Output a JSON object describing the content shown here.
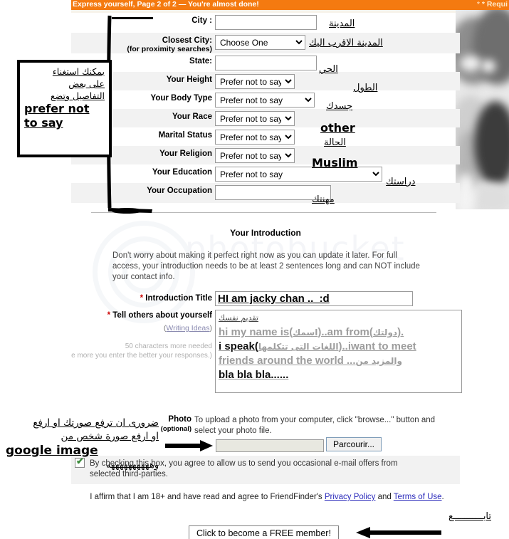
{
  "header": {
    "title": "Express yourself, Page 2 of 2 — You're almost done!",
    "required_note": "* Requi",
    "star": "*",
    "bg_color": "#f47a10"
  },
  "form": {
    "rows": [
      {
        "label": "City :",
        "sublabel": "",
        "type": "text",
        "value": "",
        "annotation": "المدينة"
      },
      {
        "label": "Closest City:",
        "sublabel": "(for proximity searches)",
        "type": "select",
        "value": "Choose One",
        "annotation": "المدينة الاقرب اليك"
      },
      {
        "label": "State:",
        "sublabel": "",
        "type": "text",
        "value": "",
        "annotation": "الحي"
      },
      {
        "label": "Your Height",
        "sublabel": "",
        "type": "select",
        "value": "Prefer not to say",
        "annotation": "الطول"
      },
      {
        "label": "Your Body Type",
        "sublabel": "",
        "type": "select",
        "value": "Prefer not to say",
        "annotation": "جسدك"
      },
      {
        "label": "Your Race",
        "sublabel": "",
        "type": "select",
        "value": "Prefer not to say",
        "annotation": "other"
      },
      {
        "label": "Marital Status",
        "sublabel": "",
        "type": "select",
        "value": "Prefer not to say",
        "annotation": "الحالة"
      },
      {
        "label": "Your Religion",
        "sublabel": "",
        "type": "select",
        "value": "Prefer not to say",
        "annotation": "Muslim"
      },
      {
        "label": "Your Education",
        "sublabel": "",
        "type": "select",
        "value": "Prefer not to say",
        "annotation": "دراستك"
      },
      {
        "label": "Your Occupation",
        "sublabel": "",
        "type": "text",
        "value": "",
        "annotation": "مهنتك"
      }
    ]
  },
  "intro": {
    "heading": "Your Introduction",
    "description": "Don't worry about making it perfect right now as you can update it later. For full access, your introduction needs to be at least 2 sentences long and can NOT include your contact info.",
    "title_label": "Introduction Title",
    "title_value": "HI am jacky chan ..  :d",
    "tell_label": "Tell others about yourself",
    "writing_ideas": "Writing Ideas",
    "writing_ideas_open": "(",
    "writing_ideas_close": ")",
    "char_counter": "50 characters more needed",
    "char_hint": "(The more you enter the better your responses.)",
    "textarea": {
      "arabic_heading": "تقديم نفسك",
      "line1_a": "hi my name is(",
      "line1_ar": "اسمك",
      "line1_b": ")..am from(",
      "line1_ar2": "دولتك",
      "line1_c": ").",
      "line2_a": "i speak(",
      "line2_ar": "اللغات التى تتكلمها",
      "line2_b": ")..iwant to meet",
      "line3_a": "friends around the world ...",
      "line3_ar": "والمزيد من",
      "line4": "bla bla bla......"
    }
  },
  "photo": {
    "label": "Photo",
    "optional": "(optional)",
    "instructions": "To upload a photo from your computer, click \"browse...\" button and select your photo file.",
    "file_value": "",
    "browse_label": "Parcourir..."
  },
  "consent": {
    "checkbox_checked": true,
    "checkmark": "✔",
    "text": "By checking this box, you agree to allow us to send you occasional e-mail offers from selected third-parties."
  },
  "affirm": {
    "part1": "I affirm that I am 18+ and have read and agree to FriendFinder's ",
    "privacy_link": "Privacy Policy",
    "part2": " and ",
    "terms_link": "Terms of Use",
    "part3": "."
  },
  "submit": {
    "label": "Click to become a FREE member!"
  },
  "annotations": {
    "note_box": {
      "line1": "يمكنك استغناء",
      "line2": "على بعض",
      "line3": "التفاصيل وتضع",
      "line4": "prefer not",
      "line5": "to say"
    },
    "photo_note": {
      "line1": "ضرورى ان ترفع صورتك او ارفع",
      "line2": "او ارفع صورة شخص من",
      "line3": "google image",
      "line4": "وههههههههههه"
    },
    "bottom_note": "تابـــــــــــع"
  }
}
